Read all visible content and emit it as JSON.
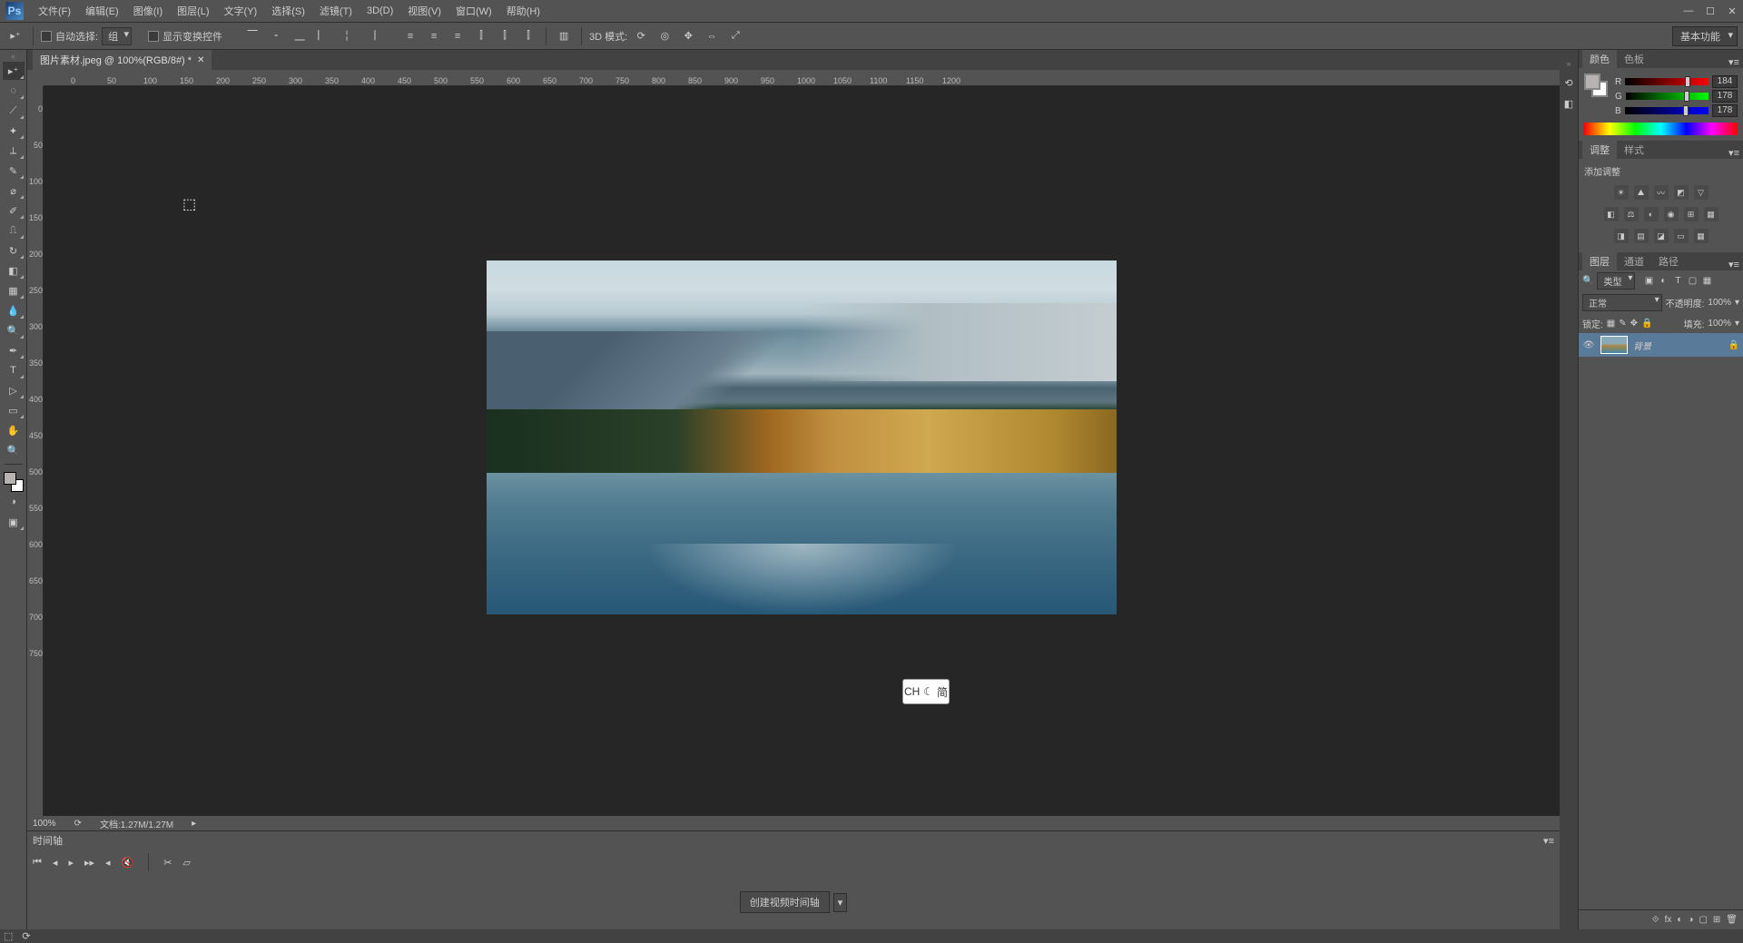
{
  "app": {
    "logo": "Ps"
  },
  "menu": [
    "文件(F)",
    "编辑(E)",
    "图像(I)",
    "图层(L)",
    "文字(Y)",
    "选择(S)",
    "滤镜(T)",
    "3D(D)",
    "视图(V)",
    "窗口(W)",
    "帮助(H)"
  ],
  "options": {
    "auto_select_label": "自动选择:",
    "group": "组",
    "show_transform": "显示变换控件",
    "mode_3d_label": "3D 模式:"
  },
  "workspace_switcher": "基本功能",
  "doc_tab": {
    "title": "图片素材.jpeg @ 100%(RGB/8#) *"
  },
  "ruler_ticks_h": [
    0,
    50,
    100,
    150,
    200,
    250,
    300,
    350,
    400,
    450,
    500,
    550,
    600,
    650,
    700,
    750,
    800,
    850,
    900,
    950,
    1000,
    1050,
    1100,
    1150,
    1200
  ],
  "ruler_ticks_v": [
    0,
    50,
    100,
    150,
    200,
    250,
    300,
    350,
    400,
    450,
    500,
    550,
    600,
    650,
    700,
    750
  ],
  "status": {
    "zoom": "100%",
    "doc": "文档:1.27M/1.27M"
  },
  "timeline": {
    "title": "时间轴",
    "create_btn": "创建视频时间轴"
  },
  "color_panel": {
    "tab_color": "颜色",
    "tab_swatches": "色板",
    "r_label": "R",
    "g_label": "G",
    "b_label": "B",
    "r": "184",
    "g": "178",
    "b": "178"
  },
  "adjust_panel": {
    "tab_adjust": "调整",
    "tab_styles": "样式",
    "add_label": "添加调整"
  },
  "layers_panel": {
    "tab_layers": "图层",
    "tab_channels": "通道",
    "tab_paths": "路径",
    "filter_kind": "类型",
    "blend_mode": "正常",
    "opacity_label": "不透明度:",
    "opacity": "100%",
    "lock_label": "锁定:",
    "fill_label": "填充:",
    "fill": "100%",
    "layer_name": "背景"
  },
  "ime": "CH",
  "ime2": "简"
}
